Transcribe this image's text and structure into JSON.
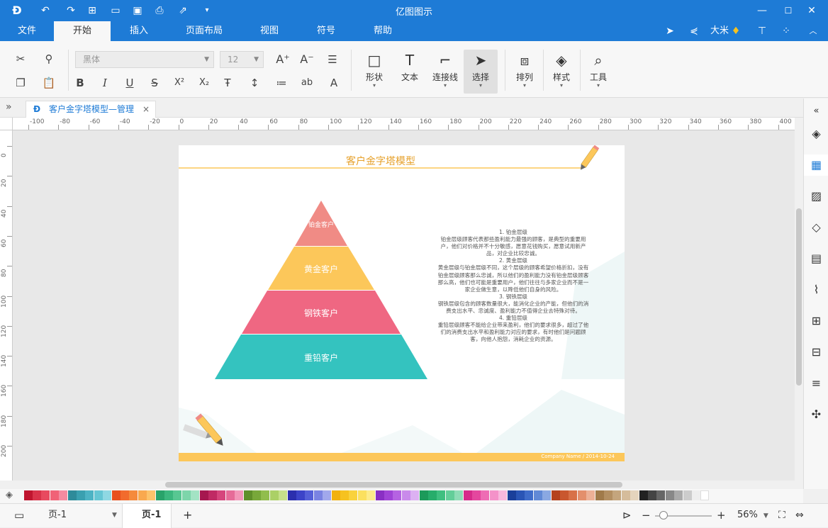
{
  "app": {
    "title": "亿图图示"
  },
  "menu": {
    "tabs": [
      "文件",
      "开始",
      "插入",
      "页面布局",
      "视图",
      "符号",
      "帮助"
    ],
    "active": "开始",
    "user": "大米"
  },
  "ribbon": {
    "font_family": "黑体",
    "font_size": "12",
    "groups": {
      "shape": "形状",
      "text": "文本",
      "connector": "连接线",
      "select": "选择",
      "arrange": "排列",
      "style": "样式",
      "tools": "工具"
    }
  },
  "document": {
    "tab_title": "客户金字塔模型—管理",
    "close_glyph": "×"
  },
  "ruler": {
    "h_ticks": [
      "-100",
      "-80",
      "-60",
      "-40",
      "-20",
      "0",
      "20",
      "40",
      "60",
      "80",
      "100",
      "120",
      "140",
      "160",
      "180",
      "200",
      "220",
      "240",
      "260",
      "280",
      "300",
      "320",
      "340",
      "360",
      "380",
      "400"
    ],
    "v_ticks": [
      "0",
      "20",
      "40",
      "60",
      "80",
      "100",
      "120",
      "140",
      "160",
      "180",
      "200"
    ]
  },
  "diagram": {
    "title": "客户金字塔模型",
    "levels": [
      "铂金客户",
      "黄金客户",
      "钢铁客户",
      "重铅客户"
    ],
    "colors": {
      "platinum": "#f08b85",
      "gold": "#fcc75a",
      "steel": "#ef6782",
      "lead": "#34c3bf",
      "title": "#e6a02a",
      "footer_bar": "#fcc75a"
    },
    "description": [
      "1. 铂金层级",
      "铂金层级顾客代表那些盈利能力最强的顾客，是典型的重要用户，他们对价格并不十分敏感，愿意花钱购买，愿意试用新产品，对企业比较忠诚。",
      "2. 黄金层级",
      "黄金层级与铂金层级不同，这个层级的顾客希望价格折扣，没有铂金层级顾客那么忠诚，所以他们的盈利能力没有铂金层级顾客那么高，他们也可能是重要用户，他们往往与多家企业而不是一家企业做生意，以降低他们自身的风险。",
      "3. 钢铁层级",
      "钢铁层级包含的顾客数量很大，能消化企业的产能，但他们的消费支出水平、忠诚度、盈利能力不值得企业去特殊对待。",
      "4. 重铅层级",
      "重铅层级顾客不能给企业带来盈利，他们的要求很多，超过了他们的消费支出水平和盈利能力对应的要求，有时他们是问题顾客，向他人抱怨，消耗企业的资源。"
    ],
    "footer": "Company Name / 2014-10-24"
  },
  "status": {
    "page_select": "页-1",
    "page_tab": "页-1",
    "add_page": "+",
    "zoom": "56%",
    "zoom_minus": "−",
    "zoom_plus": "+"
  },
  "palette": [
    "#c0152f",
    "#d9334a",
    "#e84a5f",
    "#f06277",
    "#f48ba0",
    "#2e8b9a",
    "#3aa0b0",
    "#4db3c4",
    "#66c6d4",
    "#8fd8e3",
    "#e8501e",
    "#f26b2d",
    "#f58a3c",
    "#f9a94f",
    "#fcc36b",
    "#29a36a",
    "#3cb77e",
    "#58c792",
    "#7dd5aa",
    "#a3e3c4",
    "#a6174f",
    "#c02a64",
    "#d6457c",
    "#e66b98",
    "#f296b8",
    "#5f8f2a",
    "#78a83a",
    "#91bd4d",
    "#abd066",
    "#c6e08a",
    "#2b2fae",
    "#3c44c8",
    "#5560d8",
    "#7a83e2",
    "#a1a8ec",
    "#f2b10f",
    "#f6c21f",
    "#f9d23c",
    "#fbe05f",
    "#fdeb8a",
    "#8a2fc4",
    "#a044d6",
    "#b563e2",
    "#c98aeb",
    "#dcb1f2",
    "#1c9a5a",
    "#27ad6b",
    "#3fbf80",
    "#63ce99",
    "#8edcb6",
    "#d62b8a",
    "#e4479e",
    "#ee6cb4",
    "#f492c9",
    "#f8b8dd",
    "#1a3f9a",
    "#2a55b5",
    "#3f6cc9",
    "#6189d6",
    "#8aa8e2",
    "#b5421f",
    "#c9572f",
    "#d87148",
    "#e38f6c",
    "#ecb096",
    "#a07a4a",
    "#b38f62",
    "#c4a57d",
    "#d5bc9b",
    "#e5d4bd",
    "#222222",
    "#444444",
    "#666666",
    "#888888",
    "#aaaaaa",
    "#cccccc",
    "#eeeeee",
    "#ffffff"
  ]
}
